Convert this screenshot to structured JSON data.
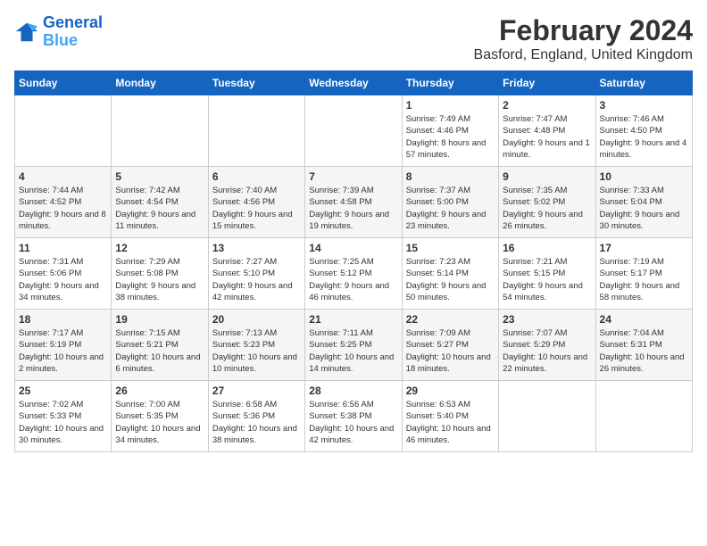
{
  "logo": {
    "line1": "General",
    "line2": "Blue"
  },
  "title": "February 2024",
  "location": "Basford, England, United Kingdom",
  "headers": [
    "Sunday",
    "Monday",
    "Tuesday",
    "Wednesday",
    "Thursday",
    "Friday",
    "Saturday"
  ],
  "weeks": [
    [
      {
        "day": "",
        "sunrise": "",
        "sunset": "",
        "daylight": ""
      },
      {
        "day": "",
        "sunrise": "",
        "sunset": "",
        "daylight": ""
      },
      {
        "day": "",
        "sunrise": "",
        "sunset": "",
        "daylight": ""
      },
      {
        "day": "",
        "sunrise": "",
        "sunset": "",
        "daylight": ""
      },
      {
        "day": "1",
        "sunrise": "Sunrise: 7:49 AM",
        "sunset": "Sunset: 4:46 PM",
        "daylight": "Daylight: 8 hours and 57 minutes."
      },
      {
        "day": "2",
        "sunrise": "Sunrise: 7:47 AM",
        "sunset": "Sunset: 4:48 PM",
        "daylight": "Daylight: 9 hours and 1 minute."
      },
      {
        "day": "3",
        "sunrise": "Sunrise: 7:46 AM",
        "sunset": "Sunset: 4:50 PM",
        "daylight": "Daylight: 9 hours and 4 minutes."
      }
    ],
    [
      {
        "day": "4",
        "sunrise": "Sunrise: 7:44 AM",
        "sunset": "Sunset: 4:52 PM",
        "daylight": "Daylight: 9 hours and 8 minutes."
      },
      {
        "day": "5",
        "sunrise": "Sunrise: 7:42 AM",
        "sunset": "Sunset: 4:54 PM",
        "daylight": "Daylight: 9 hours and 11 minutes."
      },
      {
        "day": "6",
        "sunrise": "Sunrise: 7:40 AM",
        "sunset": "Sunset: 4:56 PM",
        "daylight": "Daylight: 9 hours and 15 minutes."
      },
      {
        "day": "7",
        "sunrise": "Sunrise: 7:39 AM",
        "sunset": "Sunset: 4:58 PM",
        "daylight": "Daylight: 9 hours and 19 minutes."
      },
      {
        "day": "8",
        "sunrise": "Sunrise: 7:37 AM",
        "sunset": "Sunset: 5:00 PM",
        "daylight": "Daylight: 9 hours and 23 minutes."
      },
      {
        "day": "9",
        "sunrise": "Sunrise: 7:35 AM",
        "sunset": "Sunset: 5:02 PM",
        "daylight": "Daylight: 9 hours and 26 minutes."
      },
      {
        "day": "10",
        "sunrise": "Sunrise: 7:33 AM",
        "sunset": "Sunset: 5:04 PM",
        "daylight": "Daylight: 9 hours and 30 minutes."
      }
    ],
    [
      {
        "day": "11",
        "sunrise": "Sunrise: 7:31 AM",
        "sunset": "Sunset: 5:06 PM",
        "daylight": "Daylight: 9 hours and 34 minutes."
      },
      {
        "day": "12",
        "sunrise": "Sunrise: 7:29 AM",
        "sunset": "Sunset: 5:08 PM",
        "daylight": "Daylight: 9 hours and 38 minutes."
      },
      {
        "day": "13",
        "sunrise": "Sunrise: 7:27 AM",
        "sunset": "Sunset: 5:10 PM",
        "daylight": "Daylight: 9 hours and 42 minutes."
      },
      {
        "day": "14",
        "sunrise": "Sunrise: 7:25 AM",
        "sunset": "Sunset: 5:12 PM",
        "daylight": "Daylight: 9 hours and 46 minutes."
      },
      {
        "day": "15",
        "sunrise": "Sunrise: 7:23 AM",
        "sunset": "Sunset: 5:14 PM",
        "daylight": "Daylight: 9 hours and 50 minutes."
      },
      {
        "day": "16",
        "sunrise": "Sunrise: 7:21 AM",
        "sunset": "Sunset: 5:15 PM",
        "daylight": "Daylight: 9 hours and 54 minutes."
      },
      {
        "day": "17",
        "sunrise": "Sunrise: 7:19 AM",
        "sunset": "Sunset: 5:17 PM",
        "daylight": "Daylight: 9 hours and 58 minutes."
      }
    ],
    [
      {
        "day": "18",
        "sunrise": "Sunrise: 7:17 AM",
        "sunset": "Sunset: 5:19 PM",
        "daylight": "Daylight: 10 hours and 2 minutes."
      },
      {
        "day": "19",
        "sunrise": "Sunrise: 7:15 AM",
        "sunset": "Sunset: 5:21 PM",
        "daylight": "Daylight: 10 hours and 6 minutes."
      },
      {
        "day": "20",
        "sunrise": "Sunrise: 7:13 AM",
        "sunset": "Sunset: 5:23 PM",
        "daylight": "Daylight: 10 hours and 10 minutes."
      },
      {
        "day": "21",
        "sunrise": "Sunrise: 7:11 AM",
        "sunset": "Sunset: 5:25 PM",
        "daylight": "Daylight: 10 hours and 14 minutes."
      },
      {
        "day": "22",
        "sunrise": "Sunrise: 7:09 AM",
        "sunset": "Sunset: 5:27 PM",
        "daylight": "Daylight: 10 hours and 18 minutes."
      },
      {
        "day": "23",
        "sunrise": "Sunrise: 7:07 AM",
        "sunset": "Sunset: 5:29 PM",
        "daylight": "Daylight: 10 hours and 22 minutes."
      },
      {
        "day": "24",
        "sunrise": "Sunrise: 7:04 AM",
        "sunset": "Sunset: 5:31 PM",
        "daylight": "Daylight: 10 hours and 26 minutes."
      }
    ],
    [
      {
        "day": "25",
        "sunrise": "Sunrise: 7:02 AM",
        "sunset": "Sunset: 5:33 PM",
        "daylight": "Daylight: 10 hours and 30 minutes."
      },
      {
        "day": "26",
        "sunrise": "Sunrise: 7:00 AM",
        "sunset": "Sunset: 5:35 PM",
        "daylight": "Daylight: 10 hours and 34 minutes."
      },
      {
        "day": "27",
        "sunrise": "Sunrise: 6:58 AM",
        "sunset": "Sunset: 5:36 PM",
        "daylight": "Daylight: 10 hours and 38 minutes."
      },
      {
        "day": "28",
        "sunrise": "Sunrise: 6:56 AM",
        "sunset": "Sunset: 5:38 PM",
        "daylight": "Daylight: 10 hours and 42 minutes."
      },
      {
        "day": "29",
        "sunrise": "Sunrise: 6:53 AM",
        "sunset": "Sunset: 5:40 PM",
        "daylight": "Daylight: 10 hours and 46 minutes."
      },
      {
        "day": "",
        "sunrise": "",
        "sunset": "",
        "daylight": ""
      },
      {
        "day": "",
        "sunrise": "",
        "sunset": "",
        "daylight": ""
      }
    ]
  ]
}
